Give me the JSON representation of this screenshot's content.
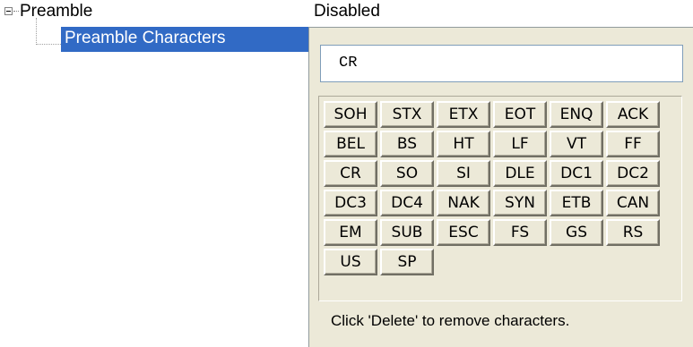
{
  "tree": {
    "parent_label": "Preamble",
    "parent_value": "Disabled",
    "child_label": "Preamble Characters",
    "selection_color": "#316ac5"
  },
  "editor": {
    "value": "CR",
    "keys": [
      "SOH",
      "STX",
      "ETX",
      "EOT",
      "ENQ",
      "ACK",
      "BEL",
      "BS",
      "HT",
      "LF",
      "VT",
      "FF",
      "CR",
      "SO",
      "SI",
      "DLE",
      "DC1",
      "DC2",
      "DC3",
      "DC4",
      "NAK",
      "SYN",
      "ETB",
      "CAN",
      "EM",
      "SUB",
      "ESC",
      "FS",
      "GS",
      "RS",
      "US",
      "SP"
    ],
    "hint": "Click 'Delete' to remove characters."
  }
}
